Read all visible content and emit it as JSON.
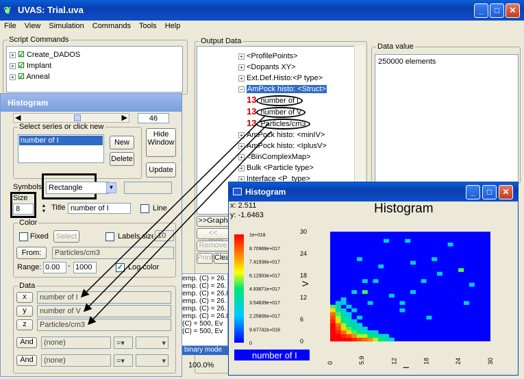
{
  "main": {
    "title": "UVAS: Trial.uva",
    "menu": [
      "File",
      "View",
      "Simulation",
      "Commands",
      "Tools",
      "Help"
    ]
  },
  "script_panel": {
    "label": "Script Commands",
    "items": [
      "Create_DADOS",
      "Implant",
      "Anneal"
    ]
  },
  "output_panel": {
    "label": "Output Data",
    "items": [
      "<ProfilePoints>",
      "<Dopants XY>",
      "Ext.Def.Histo:<P type>",
      "AmPock histo: <Struct>",
      "number of I",
      "number of V",
      "Particles/cm3",
      "AmPock histo: <minIV>",
      "AmPock histo: <IplusV>",
      "<BinComplexMap>",
      "Bulk <Particle type>",
      "Interface <P_type>"
    ],
    "node_tag": "13",
    "buttons": [
      ">>Graph",
      "<< Graph",
      "Remove",
      "Print",
      "Clear"
    ]
  },
  "data_value": {
    "label": "Data value",
    "text": "250000 elements"
  },
  "log": {
    "lines": [
      "emp. (C) = 26.",
      "emp. (C) = 26.",
      "emp. (C) = 26.85, E",
      "emp. (C) = 26.",
      "emp. (C) = 26.",
      "emp. (C) = 26.85, E",
      "(C) = 500, Ev",
      "(C) = 500, Ev"
    ],
    "mode": "binary mode",
    "zoom": "100.0%"
  },
  "histogram_dialog": {
    "title": "Histogram",
    "slider_value": "46",
    "select_label": "Select series or click new",
    "series": [
      "number of I"
    ],
    "new_label": "New",
    "delete_label": "Delete",
    "hide_label": "Hide Window",
    "update_label": "Update",
    "symbols_label": "Symbols",
    "symbol_value": "Rectangle",
    "size_label": "Size",
    "size_value": "8",
    "title_label": "Title",
    "title_value": "number of I",
    "line_label": "Line",
    "color_label": "Color",
    "fixed_label": "Fixed",
    "select_btn": "Select",
    "labels_label": "Labels size",
    "labels_value": "10",
    "from_label": "From:",
    "from_value": "Particles/cm3",
    "range_label": "Range:",
    "range_min": "0.00",
    "range_max": "1000",
    "log_color_label": "Log color",
    "data_label": "Data",
    "x_btn": "x",
    "x_value": "number of I",
    "y_btn": "y",
    "y_value": "number of V",
    "z_btn": "z",
    "z_value": "Particles/cm3",
    "and_label": "And",
    "none": "(none)"
  },
  "plot_window": {
    "title": "Histogram",
    "x_readout": "x: 2.511",
    "y_readout": "y: -1.6463",
    "heading": "Histogram",
    "y_axis_label": "V",
    "x_axis_label": "I",
    "legend_label": "number of I",
    "colors": {
      "low": "#0000ff",
      "high": "#ff0000"
    }
  },
  "chart_data": {
    "type": "heatmap",
    "title": "Histogram",
    "xlabel": "I",
    "ylabel": "V",
    "x_ticks": [
      "0",
      "5.9",
      "12",
      "18",
      "24",
      "30"
    ],
    "y_ticks": [
      "0",
      "6",
      "12",
      "18",
      "24",
      "30"
    ],
    "xlim": [
      0,
      30
    ],
    "ylim": [
      0,
      30
    ],
    "colorbar_ticks": [
      "1e+018",
      "8.70968e+017",
      "7.41936e+017",
      "6.12903e+017",
      "4.83871e+017",
      "3.54839e+017",
      "2.25806e+017",
      "9.67742e+016",
      "0"
    ],
    "colorbar_range": [
      0,
      1e+18
    ],
    "legend": "number of I",
    "cells": [
      [
        0,
        0,
        1
      ],
      [
        1,
        0,
        1
      ],
      [
        2,
        0,
        1
      ],
      [
        3,
        0,
        1
      ],
      [
        4,
        0,
        0.95
      ],
      [
        5,
        0,
        0.9
      ],
      [
        6,
        0,
        0.85
      ],
      [
        7,
        0,
        0.8
      ],
      [
        8,
        0,
        0.6
      ],
      [
        9,
        0,
        0.5
      ],
      [
        10,
        0,
        0.4
      ],
      [
        11,
        0,
        0.35
      ],
      [
        0,
        1,
        1
      ],
      [
        1,
        1,
        1
      ],
      [
        2,
        1,
        0.95
      ],
      [
        3,
        1,
        0.9
      ],
      [
        4,
        1,
        0.8
      ],
      [
        5,
        1,
        0.6
      ],
      [
        6,
        1,
        0.6
      ],
      [
        7,
        1,
        0.5
      ],
      [
        8,
        1,
        0.45
      ],
      [
        9,
        1,
        0.4
      ],
      [
        10,
        1,
        0.35
      ],
      [
        0,
        2,
        1
      ],
      [
        1,
        2,
        0.95
      ],
      [
        2,
        2,
        0.85
      ],
      [
        3,
        2,
        0.7
      ],
      [
        4,
        2,
        0.55
      ],
      [
        5,
        2,
        0.45
      ],
      [
        6,
        2,
        0.4
      ],
      [
        7,
        2,
        0.35
      ],
      [
        8,
        2,
        0.3
      ],
      [
        0,
        3,
        1
      ],
      [
        1,
        3,
        0.9
      ],
      [
        2,
        3,
        0.7
      ],
      [
        3,
        3,
        0.55
      ],
      [
        4,
        3,
        0.45
      ],
      [
        5,
        3,
        0.38
      ],
      [
        6,
        3,
        0.32
      ],
      [
        0,
        4,
        1
      ],
      [
        1,
        4,
        0.85
      ],
      [
        2,
        4,
        0.6
      ],
      [
        3,
        4,
        0.45
      ],
      [
        4,
        4,
        0.4
      ],
      [
        5,
        4,
        0.33
      ],
      [
        0,
        5,
        0.95
      ],
      [
        1,
        5,
        0.7
      ],
      [
        2,
        5,
        0.5
      ],
      [
        3,
        5,
        0.4
      ],
      [
        4,
        5,
        0.3
      ],
      [
        0,
        6,
        0.9
      ],
      [
        1,
        6,
        0.6
      ],
      [
        2,
        6,
        0.45
      ],
      [
        3,
        6,
        0.35
      ],
      [
        5,
        6,
        0.3
      ],
      [
        0,
        7,
        0.85
      ],
      [
        1,
        7,
        0.55
      ],
      [
        2,
        7,
        0.4
      ],
      [
        3,
        7,
        0.3
      ],
      [
        0,
        8,
        0.7
      ],
      [
        1,
        8,
        0.45
      ],
      [
        2,
        8,
        0.35
      ],
      [
        4,
        8,
        0.3
      ],
      [
        0,
        9,
        0.55
      ],
      [
        1,
        9,
        0.4
      ],
      [
        3,
        9,
        0.3
      ],
      [
        1,
        10,
        0.35
      ],
      [
        2,
        10,
        0.3
      ],
      [
        2,
        11,
        0.3
      ],
      [
        4,
        13,
        0.3
      ],
      [
        6,
        13,
        0.55
      ],
      [
        8,
        16,
        0.3
      ],
      [
        11,
        12,
        0.3
      ],
      [
        13,
        10,
        0.3
      ],
      [
        15,
        13,
        0.3
      ],
      [
        9,
        20,
        0.3
      ],
      [
        15,
        21,
        0.3
      ],
      [
        5,
        22,
        0.3
      ],
      [
        17,
        16,
        0.3
      ],
      [
        20,
        18,
        0.3
      ],
      [
        22,
        26,
        0.3
      ],
      [
        10,
        27,
        0.3
      ],
      [
        14,
        27,
        0.3
      ],
      [
        18,
        6,
        0.3
      ],
      [
        25,
        10,
        0.3
      ],
      [
        13,
        8,
        0.3
      ],
      [
        24,
        19,
        0.55
      ],
      [
        19,
        22,
        0.3
      ],
      [
        26,
        15,
        0.3
      ],
      [
        6,
        16,
        0.3
      ],
      [
        7,
        10,
        0.3
      ]
    ]
  }
}
